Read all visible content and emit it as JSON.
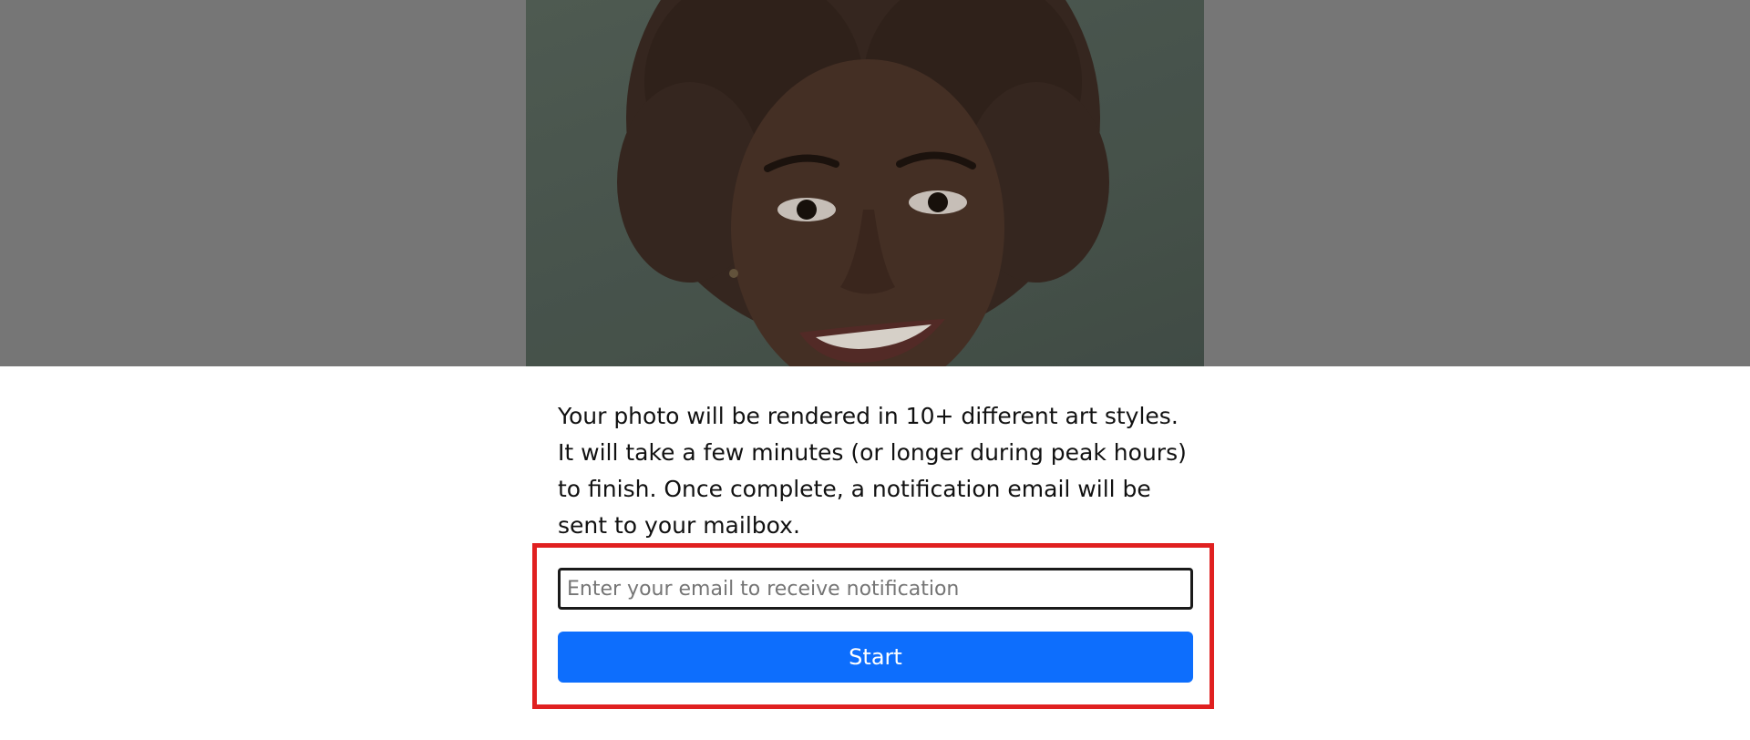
{
  "hero": {
    "image_alt": "portrait photo",
    "overlay_color": "#767676"
  },
  "description": {
    "text": "Your photo will be rendered in 10+ different art styles. It will take a few minutes (or longer during peak hours) to finish. Once complete, a notification email will be sent to your mailbox."
  },
  "form": {
    "email_placeholder": "Enter your email to receive notification",
    "email_value": "",
    "start_label": "Start",
    "highlight_color": "#e02020",
    "button_color": "#0d6efd"
  }
}
